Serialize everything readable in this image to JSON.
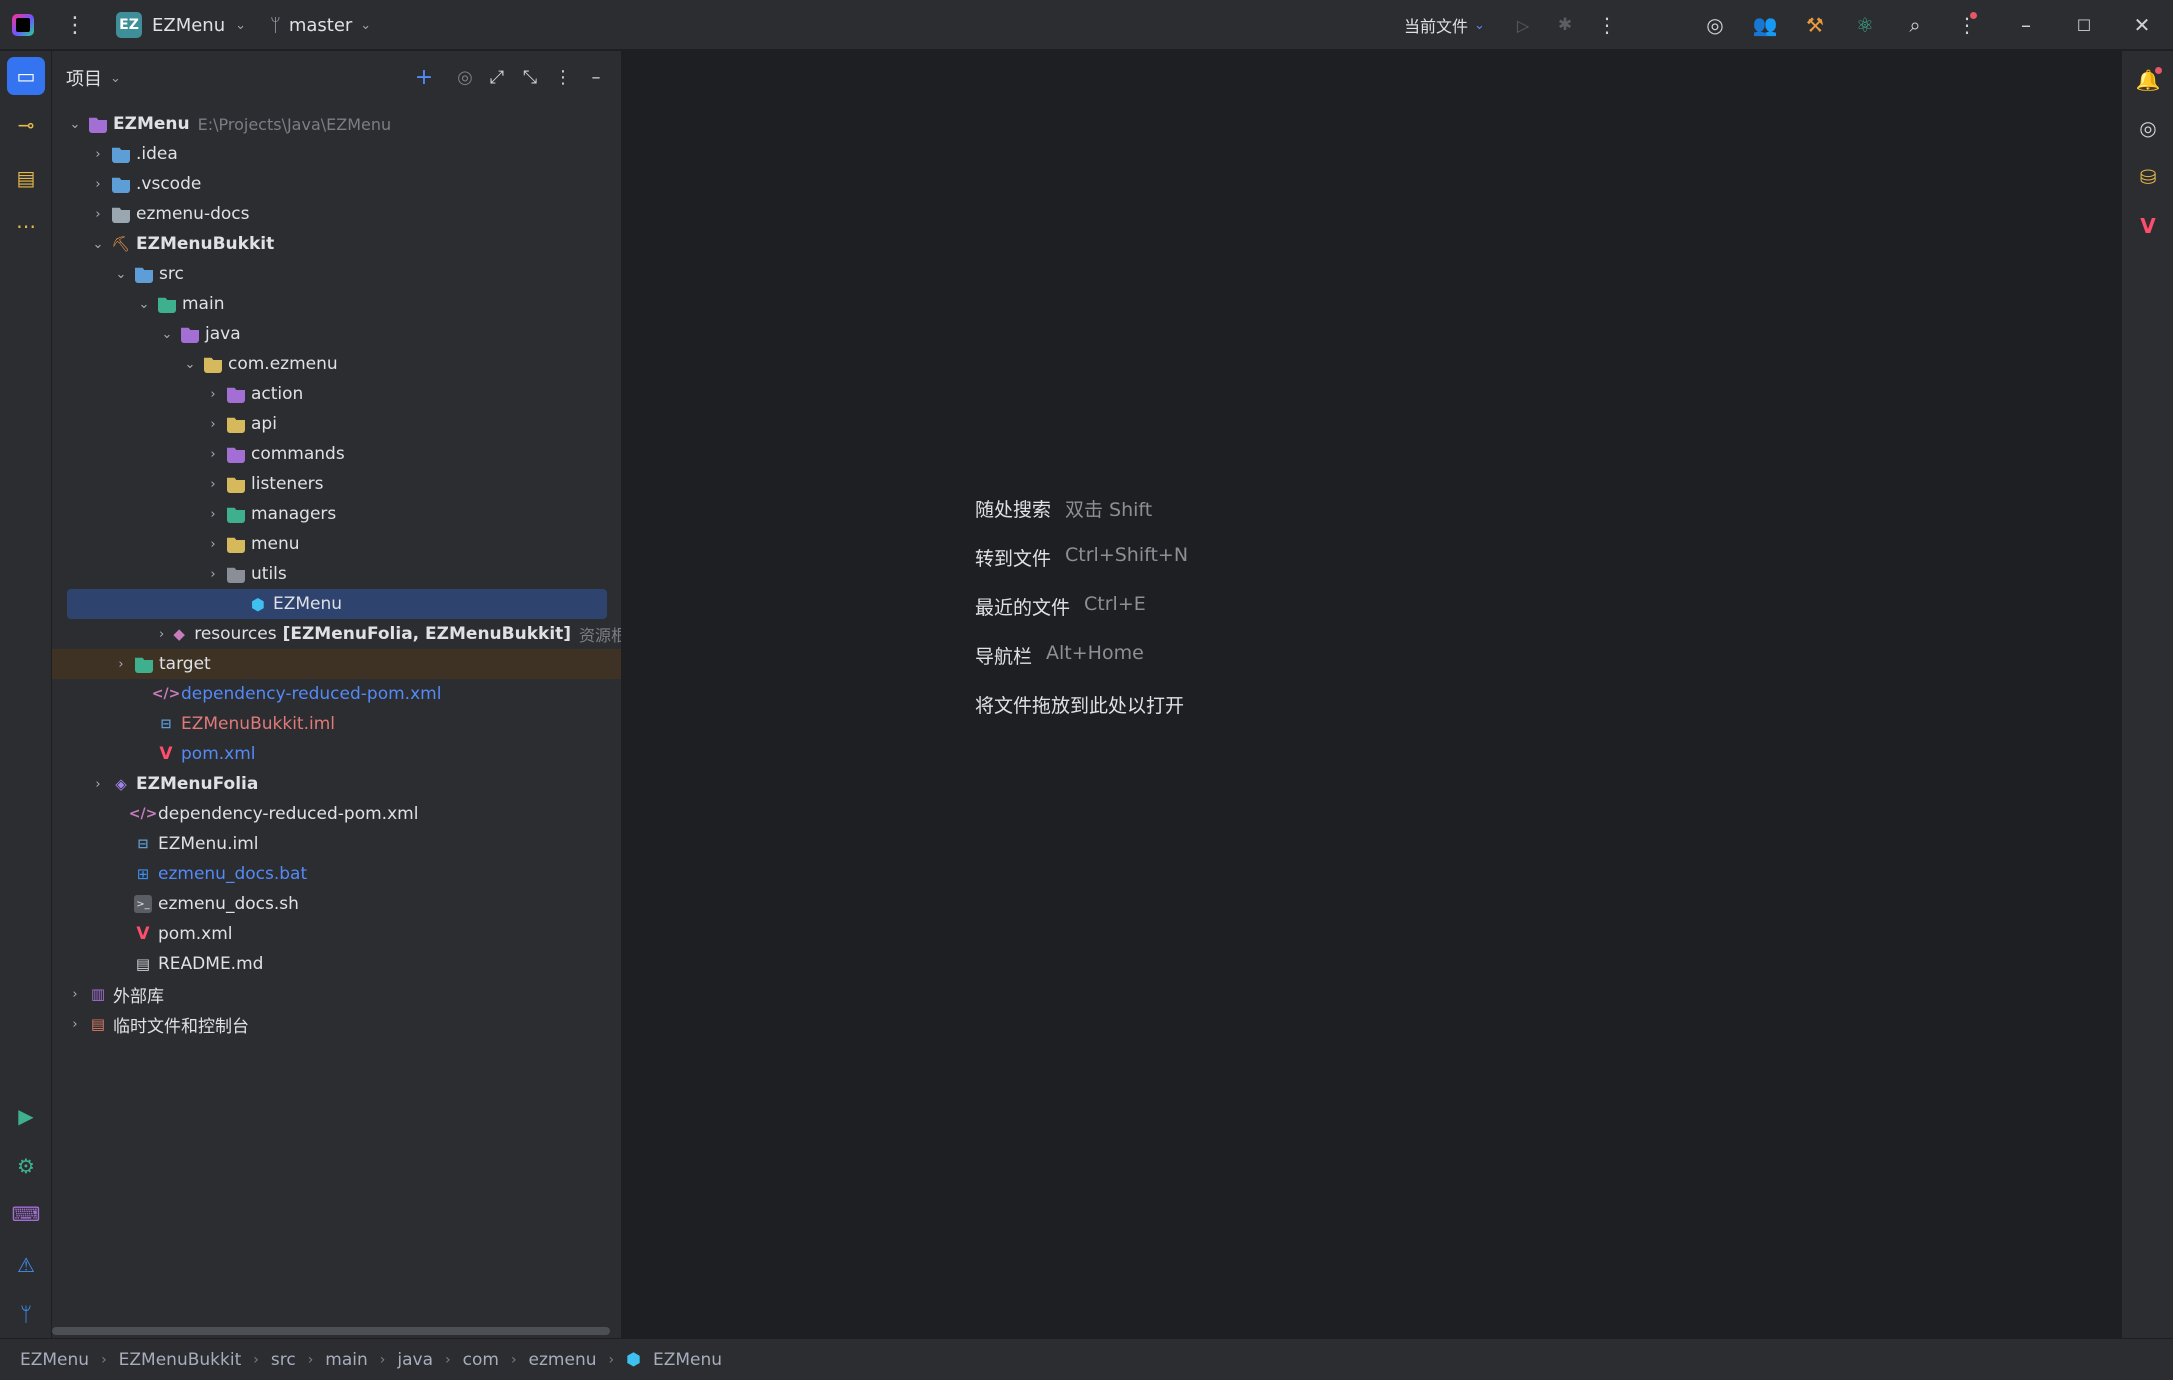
{
  "titlebar": {
    "project_badge": "EZ",
    "project_name": "EZMenu",
    "branch": "master",
    "run_config": "当前文件"
  },
  "panel": {
    "title": "项目"
  },
  "tree": [
    {
      "label": "EZMenu",
      "suffix": "E:\\Projects\\Java\\EZMenu"
    },
    {
      "label": ".idea"
    },
    {
      "label": ".vscode"
    },
    {
      "label": "ezmenu-docs"
    },
    {
      "label": "EZMenuBukkit"
    },
    {
      "label": "src"
    },
    {
      "label": "main"
    },
    {
      "label": "java"
    },
    {
      "label": "com.ezmenu"
    },
    {
      "label": "action"
    },
    {
      "label": "api"
    },
    {
      "label": "commands"
    },
    {
      "label": "listeners"
    },
    {
      "label": "managers"
    },
    {
      "label": "menu"
    },
    {
      "label": "utils"
    },
    {
      "label": "EZMenu"
    },
    {
      "label": "resources",
      "extra": "[EZMenuFolia, EZMenuBukkit]",
      "suffix": "资源根目录"
    },
    {
      "label": "target"
    },
    {
      "label": "dependency-reduced-pom.xml"
    },
    {
      "label": "EZMenuBukkit.iml"
    },
    {
      "label": "pom.xml"
    },
    {
      "label": "EZMenuFolia"
    },
    {
      "label": "dependency-reduced-pom.xml"
    },
    {
      "label": "EZMenu.iml"
    },
    {
      "label": "ezmenu_docs.bat"
    },
    {
      "label": "ezmenu_docs.sh"
    },
    {
      "label": "pom.xml"
    },
    {
      "label": "README.md"
    },
    {
      "label": "外部库"
    },
    {
      "label": "临时文件和控制台"
    }
  ],
  "editor_hints": [
    {
      "action": "随处搜索",
      "shortcut": "双击 Shift"
    },
    {
      "action": "转到文件",
      "shortcut": "Ctrl+Shift+N"
    },
    {
      "action": "最近的文件",
      "shortcut": "Ctrl+E"
    },
    {
      "action": "导航栏",
      "shortcut": "Alt+Home"
    },
    {
      "action": "将文件拖放到此处以打开",
      "shortcut": ""
    }
  ],
  "breadcrumb": [
    "EZMenu",
    "EZMenuBukkit",
    "src",
    "main",
    "java",
    "com",
    "ezmenu",
    "EZMenu"
  ],
  "colors": {
    "accent": "#3574f0",
    "selection": "#2e436e",
    "excluded": "#3d3223",
    "link_blue": "#548af7",
    "modified_red": "#e07a7a"
  }
}
